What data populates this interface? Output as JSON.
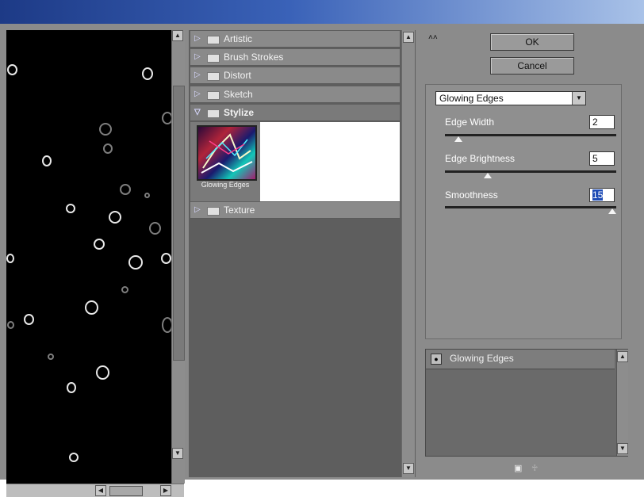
{
  "categories": [
    {
      "label": "Artistic",
      "expanded": false
    },
    {
      "label": "Brush Strokes",
      "expanded": false
    },
    {
      "label": "Distort",
      "expanded": false
    },
    {
      "label": "Sketch",
      "expanded": false
    },
    {
      "label": "Stylize",
      "expanded": true
    },
    {
      "label": "Texture",
      "expanded": false
    }
  ],
  "filter_thumbnail": {
    "label": "Glowing Edges"
  },
  "buttons": {
    "ok": "OK",
    "cancel": "Cancel"
  },
  "filter_select": {
    "value": "Glowing Edges"
  },
  "params": [
    {
      "label": "Edge Width",
      "value": "2",
      "slider_fraction": 0.1
    },
    {
      "label": "Edge Brightness",
      "value": "5",
      "slider_fraction": 0.25
    },
    {
      "label": "Smoothness",
      "value": "15",
      "slider_fraction": 1.0
    }
  ],
  "layer": {
    "name": "Glowing Edges"
  },
  "colors": {
    "accent_selection": "#1d4bb5",
    "titlebar": "#1d3a86"
  }
}
